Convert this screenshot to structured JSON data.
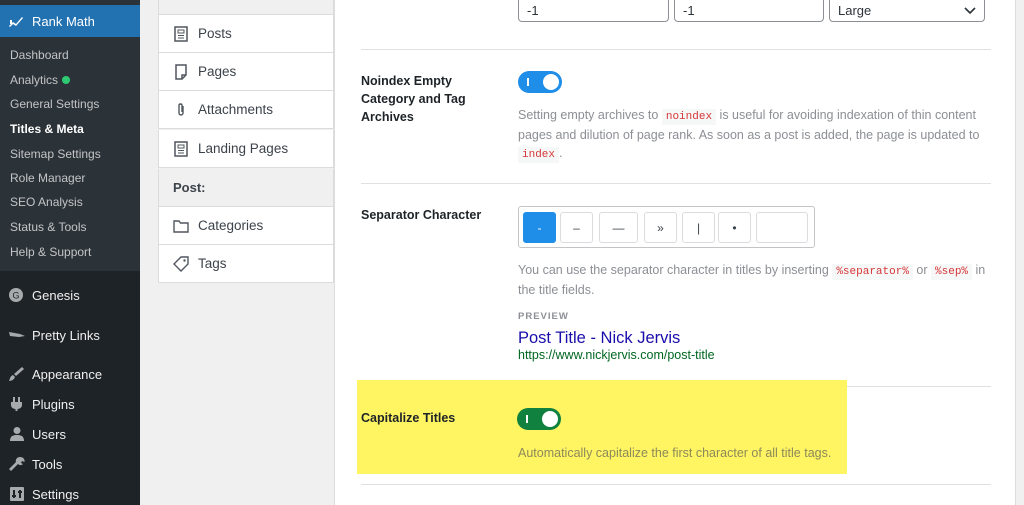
{
  "sidebar": {
    "plugin_title": "Rank Math",
    "submenu": [
      {
        "label": "Dashboard"
      },
      {
        "label": "Analytics"
      },
      {
        "label": "General Settings"
      },
      {
        "label": "Titles & Meta"
      },
      {
        "label": "Sitemap Settings"
      },
      {
        "label": "Role Manager"
      },
      {
        "label": "SEO Analysis"
      },
      {
        "label": "Status & Tools"
      },
      {
        "label": "Help & Support"
      }
    ],
    "analytics_status_color": "#2dca73",
    "menu": [
      {
        "label": "Genesis",
        "icon": "genesis-icon"
      },
      {
        "label": "Pretty Links",
        "icon": "pretty-links-icon"
      },
      {
        "label": "Appearance",
        "icon": "paintbrush-icon"
      },
      {
        "label": "Plugins",
        "icon": "plugin-icon"
      },
      {
        "label": "Users",
        "icon": "users-icon"
      },
      {
        "label": "Tools",
        "icon": "wrench-icon"
      },
      {
        "label": "Settings",
        "icon": "settings-icon"
      }
    ]
  },
  "nav": {
    "post_types": [
      {
        "label": "Posts",
        "icon": "document-icon"
      },
      {
        "label": "Pages",
        "icon": "page-icon"
      },
      {
        "label": "Attachments",
        "icon": "paperclip-icon"
      },
      {
        "label": "Landing Pages",
        "icon": "document-icon"
      }
    ],
    "post_group": "Post:",
    "taxonomies": [
      {
        "label": "Categories",
        "icon": "folder-icon"
      },
      {
        "label": "Tags",
        "icon": "tag-icon"
      }
    ]
  },
  "top_fields": {
    "field1": "-1",
    "field2": "-1",
    "select": "Large"
  },
  "noindex": {
    "label": "Noindex Empty Category and Tag Archives",
    "enabled": true,
    "desc_1": "Setting empty archives to",
    "code_1": "noindex",
    "desc_2": "is useful for avoiding indexation of thin content pages and dilution of page rank. As soon as a post is added, the page is updated to",
    "code_2": "index",
    "desc_3": "."
  },
  "separator": {
    "label": "Separator Character",
    "options": [
      "-",
      "–",
      "—",
      "»",
      "|",
      "•",
      ""
    ],
    "selected": "-",
    "desc_1": "You can use the separator character in titles by inserting",
    "code_1": "%separator%",
    "desc_or": "or",
    "code_2": "%sep%",
    "desc_2": "in the title fields.",
    "preview_label": "PREVIEW",
    "preview_title": "Post Title - Nick Jervis",
    "preview_url": "https://www.nickjervis.com/post-title"
  },
  "capitalize": {
    "label": "Capitalize Titles",
    "enabled": true,
    "desc": "Automatically capitalize the first character of all title tags."
  },
  "colors": {
    "accent": "#2271b1",
    "toggle_blue": "#1f8ee9",
    "toggle_green": "#10813f",
    "highlight": "#fff462",
    "link": "#1a0dab",
    "url": "#006621"
  }
}
